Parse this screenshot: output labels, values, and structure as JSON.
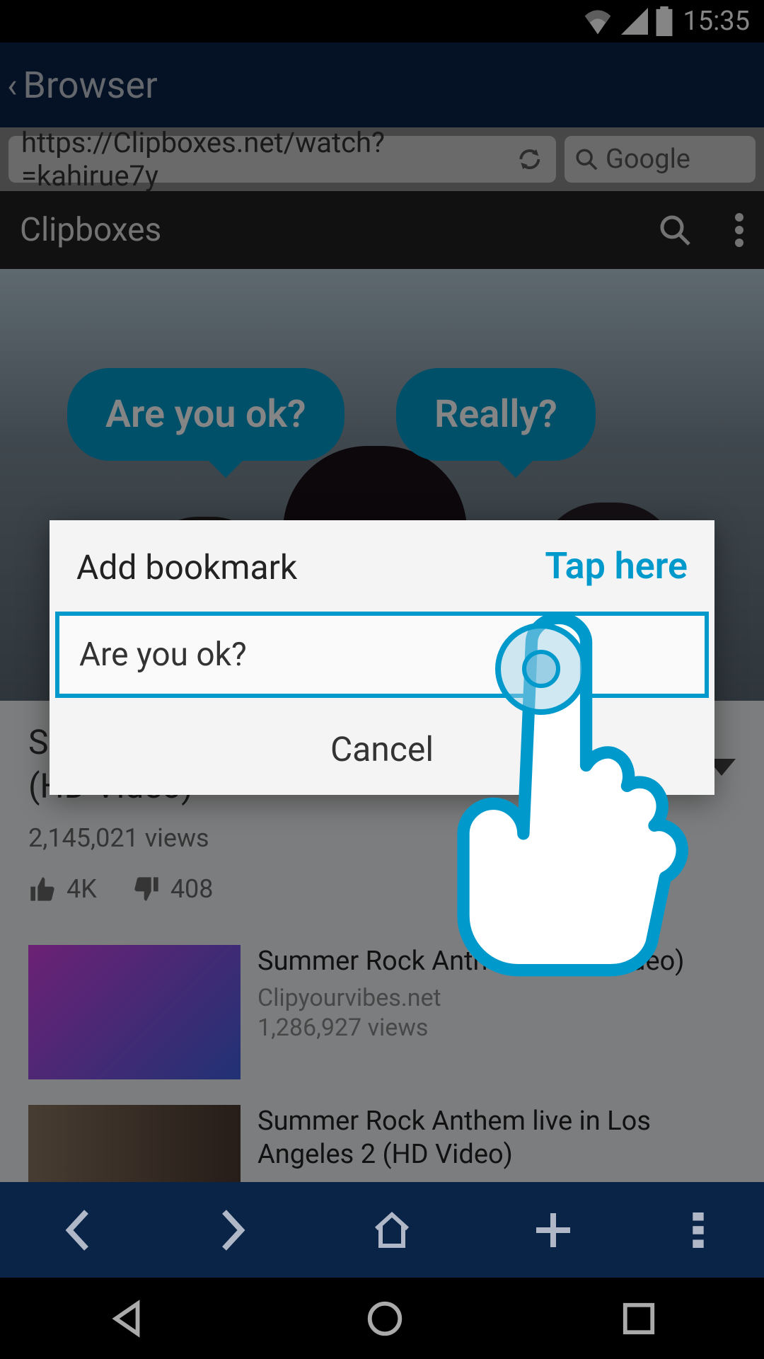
{
  "status": {
    "time": "15:35"
  },
  "topnav": {
    "title": "Browser"
  },
  "urlbar": {
    "url": "https://Clipboxes.net/watch?=kahirue7y",
    "search_placeholder": "Google"
  },
  "site": {
    "title": "Clipboxes"
  },
  "bubbles": {
    "b1": "Are you ok?",
    "b2": "Really?"
  },
  "video": {
    "title_line1": "S",
    "title_line2": "(HD Video)",
    "views": "2,145,021 views",
    "likes": "4K",
    "dislikes": "408"
  },
  "related": [
    {
      "title": "Summer Rock Anthem                                    3 (HD Video)",
      "source": "Clipyourvibes.net",
      "views": "1,286,927 views"
    },
    {
      "title": "Summer Rock Anthem live in Los Angeles 2 (HD Video)",
      "source": "",
      "views": ""
    }
  ],
  "modal": {
    "title": "Add bookmark",
    "hint": "Tap here",
    "input_value": "Are you ok?",
    "cancel": "Cancel"
  }
}
